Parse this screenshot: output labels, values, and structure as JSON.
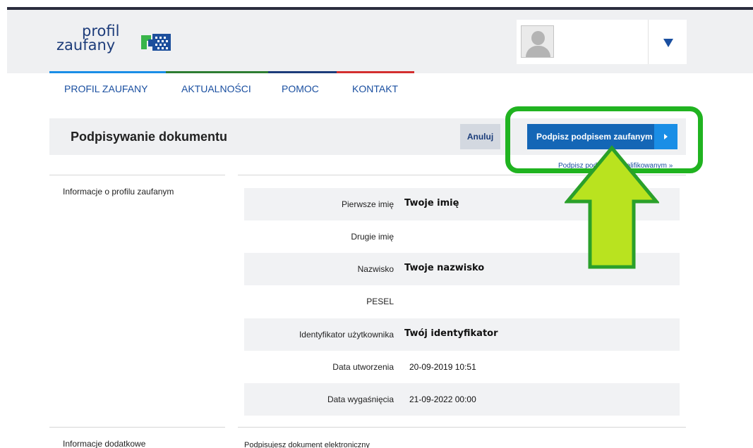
{
  "brand": {
    "logo_line1": "profil",
    "logo_line2": "zaufany",
    "colors": {
      "primary": "#1466b6",
      "accent": "#1a8ee6",
      "link": "#1a4fa0",
      "highlight": "#20b320",
      "arrow": "#b9e31f"
    }
  },
  "header": {
    "user_avatar_icon": "user-placeholder-icon",
    "menu_icon": "triangle-down-icon"
  },
  "nav": {
    "items": [
      {
        "label": "PROFIL ZAUFANY"
      },
      {
        "label": "AKTUALNOŚCI"
      },
      {
        "label": "POMOC"
      },
      {
        "label": "KONTAKT"
      }
    ]
  },
  "toolbar": {
    "title": "Podpisywanie dokumentu",
    "cancel_label": "Anuluj",
    "sign_label": "Podpisz podpisem zaufanym",
    "sign_arrow_icon": "play-right-icon",
    "qualified_link": "Podpisz podpisem kwalifikowanym »"
  },
  "profile_section": {
    "label": "Informacje o profilu zaufanym",
    "rows": [
      {
        "label": "Pierwsze imię",
        "value": "Twoje imię"
      },
      {
        "label": "Drugie imię",
        "value": ""
      },
      {
        "label": "Nazwisko",
        "value": "Twoje nazwisko"
      },
      {
        "label": "PESEL",
        "value": ""
      },
      {
        "label": "Identyfikator użytkownika",
        "value": "Twój identyfikator"
      },
      {
        "label": "Data utworzenia",
        "value": "20-09-2019 10:51"
      },
      {
        "label": "Data wygaśnięcia",
        "value": "21-09-2022 00:00"
      }
    ]
  },
  "additional_section": {
    "label": "Informacje dodatkowe",
    "text": "Podpisujesz dokument elektroniczny"
  }
}
